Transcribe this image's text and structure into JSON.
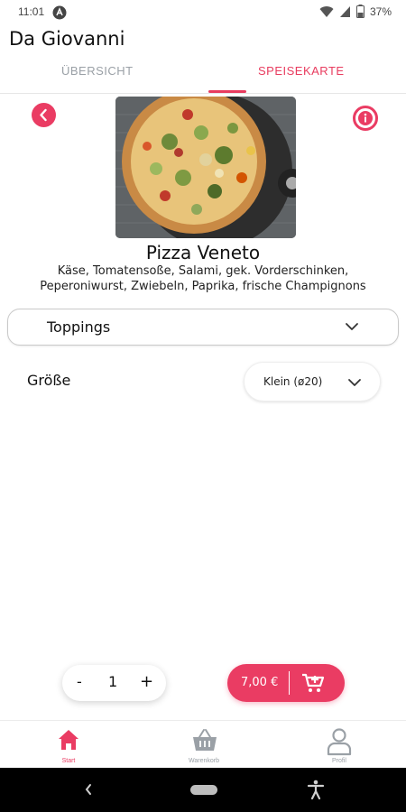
{
  "status_bar": {
    "time": "11:01",
    "battery": "37%"
  },
  "app": {
    "title": "Da Giovanni"
  },
  "tabs": [
    {
      "label": "ÜBERSICHT",
      "active": false
    },
    {
      "label": "SPEISEKARTE",
      "active": true
    }
  ],
  "product": {
    "name": "Pizza Veneto",
    "description_line1": "Käse, Tomatensoße, Salami, gek. Vorderschinken,",
    "description_line2": "Peperoniwurst, Zwiebeln, Paprika, frische Champignons"
  },
  "options": {
    "toppings_label": "Toppings",
    "size_label": "Größe",
    "size_value": "Klein (ø20)"
  },
  "order": {
    "minus": "-",
    "quantity": "1",
    "plus": "+",
    "price": "7,00 €"
  },
  "bottom_nav": [
    {
      "label": "Start",
      "icon": "home-icon",
      "active": true
    },
    {
      "label": "Warenkorb",
      "icon": "basket-icon",
      "active": false
    },
    {
      "label": "Profil",
      "icon": "person-icon",
      "active": false
    }
  ],
  "colors": {
    "accent": "#ea3c63",
    "inactive": "#9aa0a6"
  }
}
